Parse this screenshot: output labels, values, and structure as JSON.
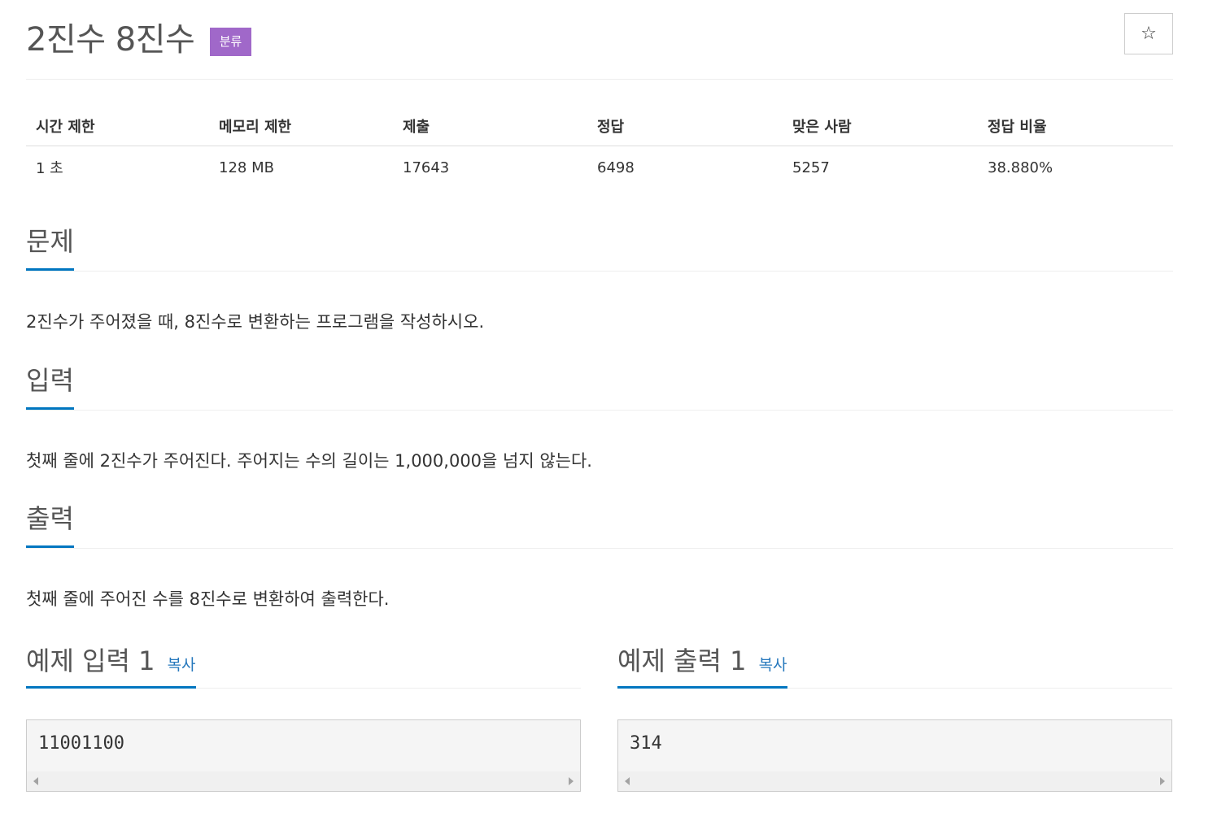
{
  "header": {
    "title": "2진수 8진수",
    "category_label": "분류",
    "star_icon": "☆"
  },
  "info_table": {
    "headers": [
      "시간 제한",
      "메모리 제한",
      "제출",
      "정답",
      "맞은 사람",
      "정답 비율"
    ],
    "values": [
      "1 초",
      "128 MB",
      "17643",
      "6498",
      "5257",
      "38.880%"
    ]
  },
  "sections": {
    "problem": {
      "title": "문제",
      "body": "2진수가 주어졌을 때, 8진수로 변환하는 프로그램을 작성하시오."
    },
    "input": {
      "title": "입력",
      "body": "첫째 줄에 2진수가 주어진다. 주어지는 수의 길이는 1,000,000을 넘지 않는다."
    },
    "output": {
      "title": "출력",
      "body": "첫째 줄에 주어진 수를 8진수로 변환하여 출력한다."
    }
  },
  "samples": {
    "input": {
      "title": "예제 입력 1",
      "copy_label": "복사",
      "code": "11001100"
    },
    "output": {
      "title": "예제 출력 1",
      "copy_label": "복사",
      "code": "314"
    }
  },
  "colors": {
    "accent": "#0076c0",
    "badge": "#a068c9",
    "link": "#2779bd"
  }
}
